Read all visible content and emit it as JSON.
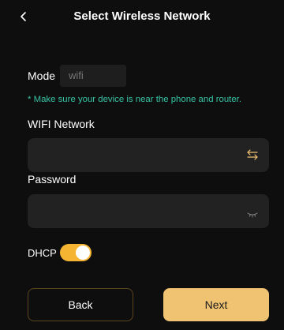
{
  "header": {
    "title": "Select Wireless Network",
    "back_icon": "chevron-left-icon"
  },
  "mode": {
    "label": "Mode",
    "value": "wifi"
  },
  "hint": "* Make sure your device is near the phone and router.",
  "wifi": {
    "label": "WIFI Network",
    "value": "",
    "icon": "switch-arrows-icon"
  },
  "password": {
    "label": "Password",
    "value": "",
    "icon": "eye-closed-icon"
  },
  "dhcp": {
    "label": "DHCP",
    "enabled": true
  },
  "buttons": {
    "back": "Back",
    "next": "Next"
  },
  "colors": {
    "background": "#0e0e0e",
    "accent": "#f0c373",
    "toggle_on": "#f5b532",
    "hint": "#38c3a5",
    "input_bg": "#222222"
  }
}
